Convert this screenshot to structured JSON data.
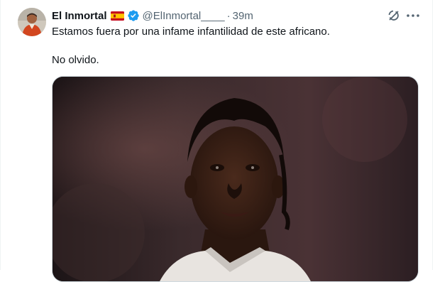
{
  "tweet": {
    "display_name": "El Inmortal",
    "flag_icon": "spain-flag-icon",
    "verified_icon": "verified-badge-icon",
    "handle": "@ElInmortal____",
    "separator": "·",
    "time": "39m",
    "text_line1": "Estamos fuera por una infame infantilidad de este africano.",
    "text_line2": "No olvido.",
    "grok_icon": "grok-icon",
    "more_icon": "more-options-icon",
    "media": "tweet-photo"
  },
  "colors": {
    "text": "#0f1419",
    "secondary": "#536471",
    "verified": "#1d9bf0",
    "border": "#cfd9de"
  }
}
